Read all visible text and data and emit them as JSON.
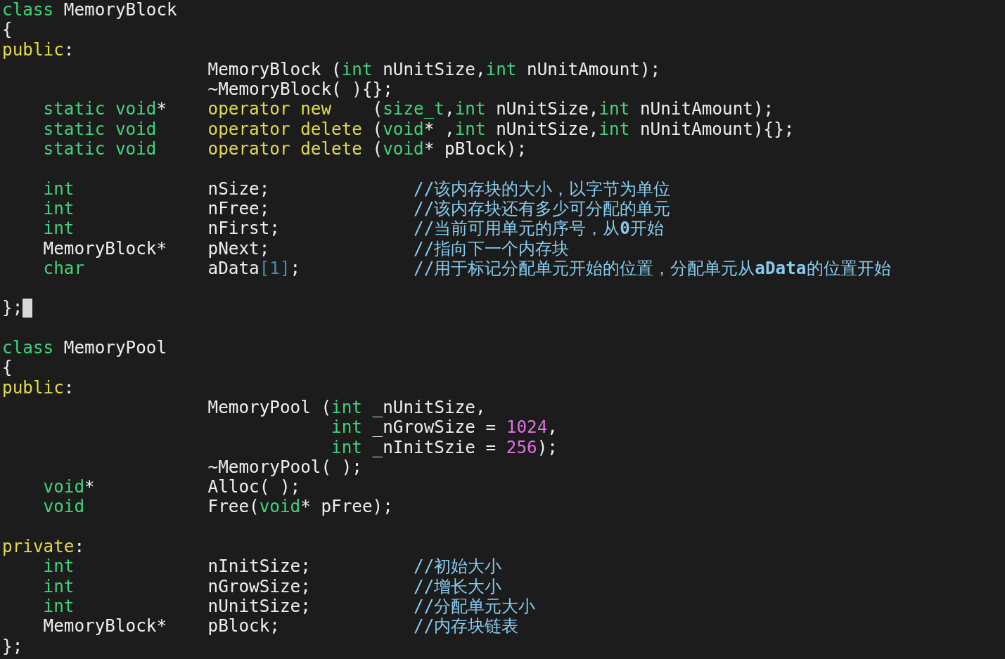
{
  "editor": {
    "lines": [
      {
        "kind": "code",
        "left": [
          {
            "kind": "type",
            "text": "class"
          },
          {
            "kind": "plain",
            "text": " MemoryBlock"
          }
        ]
      },
      {
        "kind": "code",
        "left": [
          {
            "kind": "plain",
            "text": "{"
          }
        ]
      },
      {
        "kind": "code",
        "left": [
          {
            "kind": "statement",
            "text": "public"
          },
          {
            "kind": "plain",
            "text": ":"
          }
        ]
      },
      {
        "kind": "code",
        "member": [
          {
            "kind": "plain",
            "text": "MemoryBlock ("
          },
          {
            "kind": "type",
            "text": "int"
          },
          {
            "kind": "plain",
            "text": " nUnitSize,"
          },
          {
            "kind": "type",
            "text": "int"
          },
          {
            "kind": "plain",
            "text": " nUnitAmount);"
          }
        ]
      },
      {
        "kind": "code",
        "member": [
          {
            "kind": "plain",
            "text": "~MemoryBlock( ){};"
          }
        ]
      },
      {
        "kind": "code",
        "type": [
          {
            "kind": "type",
            "text": "static void"
          },
          {
            "kind": "plain",
            "text": "*"
          }
        ],
        "member": [
          {
            "kind": "statement",
            "text": "operator new"
          },
          {
            "kind": "plain",
            "text": "    ("
          },
          {
            "kind": "type",
            "text": "size_t"
          },
          {
            "kind": "plain",
            "text": ","
          },
          {
            "kind": "type",
            "text": "int"
          },
          {
            "kind": "plain",
            "text": " nUnitSize,"
          },
          {
            "kind": "type",
            "text": "int"
          },
          {
            "kind": "plain",
            "text": " nUnitAmount);"
          }
        ]
      },
      {
        "kind": "code",
        "type": [
          {
            "kind": "type",
            "text": "static void"
          }
        ],
        "member": [
          {
            "kind": "statement",
            "text": "operator delete"
          },
          {
            "kind": "plain",
            "text": " ("
          },
          {
            "kind": "type",
            "text": "void"
          },
          {
            "kind": "plain",
            "text": "* ,"
          },
          {
            "kind": "type",
            "text": "int"
          },
          {
            "kind": "plain",
            "text": " nUnitSize,"
          },
          {
            "kind": "type",
            "text": "int"
          },
          {
            "kind": "plain",
            "text": " nUnitAmount){};"
          }
        ]
      },
      {
        "kind": "code",
        "type": [
          {
            "kind": "type",
            "text": "static void"
          }
        ],
        "member": [
          {
            "kind": "statement",
            "text": "operator delete"
          },
          {
            "kind": "plain",
            "text": " ("
          },
          {
            "kind": "type",
            "text": "void"
          },
          {
            "kind": "plain",
            "text": "* pBlock);"
          }
        ]
      },
      {
        "kind": "blank"
      },
      {
        "kind": "code",
        "type": [
          {
            "kind": "type",
            "text": "int"
          }
        ],
        "member": [
          {
            "kind": "plain",
            "text": "nSize;"
          }
        ],
        "comment": "//该内存块的大小，以字节为单位"
      },
      {
        "kind": "code",
        "type": [
          {
            "kind": "type",
            "text": "int"
          }
        ],
        "member": [
          {
            "kind": "plain",
            "text": "nFree;"
          }
        ],
        "comment": "//该内存块还有多少可分配的单元"
      },
      {
        "kind": "code",
        "type": [
          {
            "kind": "type",
            "text": "int"
          }
        ],
        "member": [
          {
            "kind": "plain",
            "text": "nFirst;"
          }
        ],
        "comment": "//当前可用单元的序号，从**0**开始"
      },
      {
        "kind": "code",
        "type": [
          {
            "kind": "plain",
            "text": "MemoryBlock*"
          }
        ],
        "member": [
          {
            "kind": "plain",
            "text": "pNext;"
          }
        ],
        "comment": "//指向下一个内存块"
      },
      {
        "kind": "code",
        "type": [
          {
            "kind": "type",
            "text": "char"
          }
        ],
        "member": [
          {
            "kind": "plain",
            "text": "aData"
          },
          {
            "kind": "special",
            "text": "[1]"
          },
          {
            "kind": "plain",
            "text": ";"
          }
        ],
        "comment": "//用于标记分配单元开始的位置，分配单元从**aData**的位置开始"
      },
      {
        "kind": "blank"
      },
      {
        "kind": "code",
        "left": [
          {
            "kind": "plain",
            "text": "};"
          }
        ],
        "cursor": true
      },
      {
        "kind": "blank"
      },
      {
        "kind": "code",
        "left": [
          {
            "kind": "type",
            "text": "class"
          },
          {
            "kind": "plain",
            "text": " MemoryPool"
          }
        ]
      },
      {
        "kind": "code",
        "left": [
          {
            "kind": "plain",
            "text": "{"
          }
        ]
      },
      {
        "kind": "code",
        "left": [
          {
            "kind": "statement",
            "text": "public"
          },
          {
            "kind": "plain",
            "text": ":"
          }
        ]
      },
      {
        "kind": "code",
        "member": [
          {
            "kind": "plain",
            "text": "MemoryPool ("
          },
          {
            "kind": "type",
            "text": "int"
          },
          {
            "kind": "plain",
            "text": " _nUnitSize,"
          }
        ]
      },
      {
        "kind": "code",
        "param": [
          {
            "kind": "type",
            "text": "int"
          },
          {
            "kind": "plain",
            "text": " _nGrowSize = "
          },
          {
            "kind": "number",
            "text": "1024"
          },
          {
            "kind": "plain",
            "text": ","
          }
        ]
      },
      {
        "kind": "code",
        "param": [
          {
            "kind": "type",
            "text": "int"
          },
          {
            "kind": "plain",
            "text": " _nInitSzie = "
          },
          {
            "kind": "number",
            "text": "256"
          },
          {
            "kind": "plain",
            "text": ");"
          }
        ]
      },
      {
        "kind": "code",
        "member": [
          {
            "kind": "plain",
            "text": "~MemoryPool( );"
          }
        ]
      },
      {
        "kind": "code",
        "type": [
          {
            "kind": "type",
            "text": "void"
          },
          {
            "kind": "plain",
            "text": "*"
          }
        ],
        "member": [
          {
            "kind": "plain",
            "text": "Alloc( );"
          }
        ]
      },
      {
        "kind": "code",
        "type": [
          {
            "kind": "type",
            "text": "void"
          }
        ],
        "member": [
          {
            "kind": "plain",
            "text": "Free("
          },
          {
            "kind": "type",
            "text": "void"
          },
          {
            "kind": "plain",
            "text": "* pFree);"
          }
        ]
      },
      {
        "kind": "blank"
      },
      {
        "kind": "code",
        "left": [
          {
            "kind": "statement",
            "text": "private"
          },
          {
            "kind": "plain",
            "text": ":"
          }
        ]
      },
      {
        "kind": "code",
        "type": [
          {
            "kind": "type",
            "text": "int"
          }
        ],
        "member": [
          {
            "kind": "plain",
            "text": "nInitSize;"
          }
        ],
        "comment": "//初始大小"
      },
      {
        "kind": "code",
        "type": [
          {
            "kind": "type",
            "text": "int"
          }
        ],
        "member": [
          {
            "kind": "plain",
            "text": "nGrowSize;"
          }
        ],
        "comment": "//增长大小"
      },
      {
        "kind": "code",
        "type": [
          {
            "kind": "type",
            "text": "int"
          }
        ],
        "member": [
          {
            "kind": "plain",
            "text": "nUnitSize;"
          }
        ],
        "comment": "//分配单元大小"
      },
      {
        "kind": "code",
        "type": [
          {
            "kind": "plain",
            "text": "MemoryBlock*"
          }
        ],
        "member": [
          {
            "kind": "plain",
            "text": "pBlock;"
          }
        ],
        "comment": "//内存块链表"
      },
      {
        "kind": "code",
        "left": [
          {
            "kind": "plain",
            "text": "};"
          }
        ]
      }
    ]
  }
}
